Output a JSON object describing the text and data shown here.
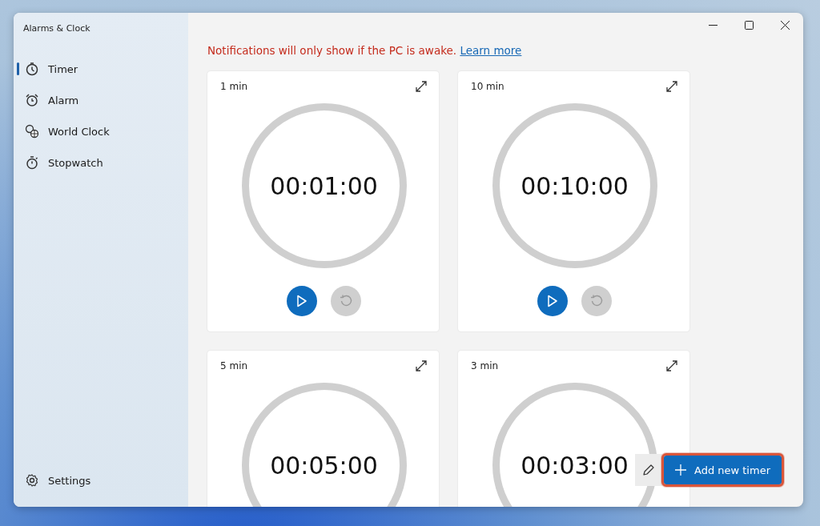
{
  "window": {
    "title": "Alarms & Clock"
  },
  "sidebar": {
    "items": [
      {
        "label": "Timer",
        "selected": true
      },
      {
        "label": "Alarm",
        "selected": false
      },
      {
        "label": "World Clock",
        "selected": false
      },
      {
        "label": "Stopwatch",
        "selected": false
      }
    ],
    "footer": {
      "label": "Settings"
    }
  },
  "notice": {
    "text": "Notifications will only show if the PC is awake.",
    "link": "Learn more"
  },
  "timers": [
    {
      "name": "1 min",
      "time": "00:01:00",
      "reset_disabled": true
    },
    {
      "name": "10 min",
      "time": "00:10:00",
      "reset_disabled": true
    },
    {
      "name": "5 min",
      "time": "00:05:00"
    },
    {
      "name": "3 min",
      "time": "00:03:00"
    }
  ],
  "add_button": {
    "label": "Add new timer",
    "highlighted": true
  }
}
